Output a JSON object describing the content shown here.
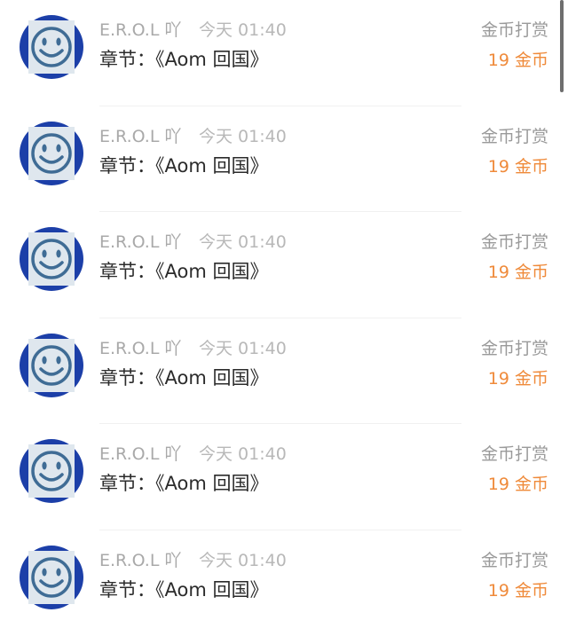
{
  "rows": [
    {
      "username": "E.R.O.L 吖",
      "time": "今天 01:40",
      "chapter": "章节：《Aom 回国》",
      "type": "金币打赏",
      "amount": "19 金币"
    },
    {
      "username": "E.R.O.L 吖",
      "time": "今天 01:40",
      "chapter": "章节：《Aom 回国》",
      "type": "金币打赏",
      "amount": "19 金币"
    },
    {
      "username": "E.R.O.L 吖",
      "time": "今天 01:40",
      "chapter": "章节：《Aom 回国》",
      "type": "金币打赏",
      "amount": "19 金币"
    },
    {
      "username": "E.R.O.L 吖",
      "time": "今天 01:40",
      "chapter": "章节：《Aom 回国》",
      "type": "金币打赏",
      "amount": "19 金币"
    },
    {
      "username": "E.R.O.L 吖",
      "time": "今天 01:40",
      "chapter": "章节：《Aom 回国》",
      "type": "金币打赏",
      "amount": "19 金币"
    },
    {
      "username": "E.R.O.L 吖",
      "time": "今天 01:40",
      "chapter": "章节：《Aom 回国》",
      "type": "金币打赏",
      "amount": "19 金币"
    }
  ],
  "colors": {
    "avatar_ring": "#1c3fa8",
    "avatar_face_bg": "#dfe7ee",
    "avatar_face_line": "#3f6c95",
    "amount": "#ef8a3a",
    "username": "#a9a9a9",
    "time": "#b8b8b8",
    "chapter": "#2b2b2b",
    "type": "#9a9a9a"
  },
  "icons": {
    "avatar": "smiley-face-icon"
  }
}
